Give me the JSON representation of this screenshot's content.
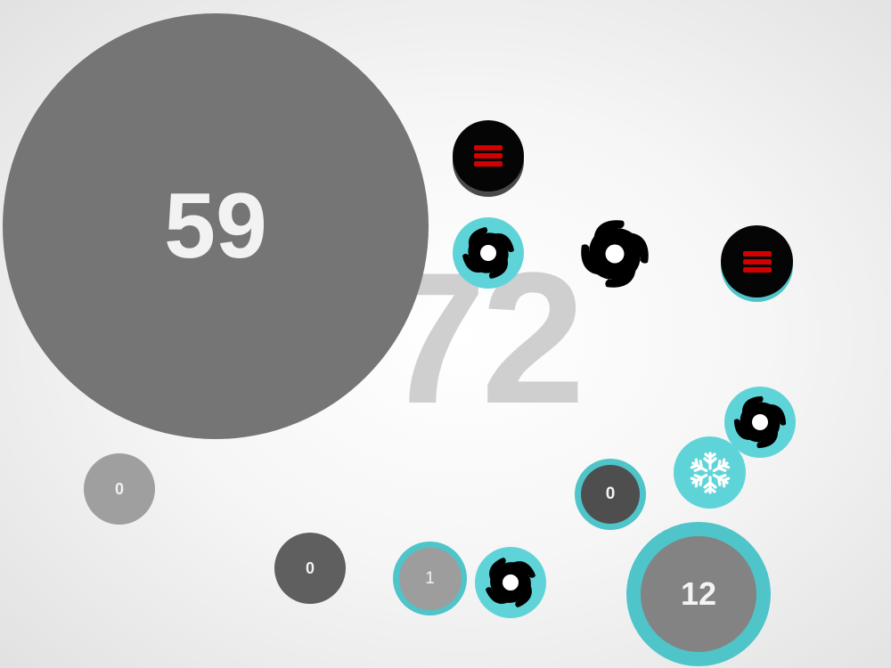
{
  "game": {
    "background_score": "72",
    "score_bubble": "59"
  },
  "bubbles": {
    "gray_zero": "0",
    "dark_zero": "0",
    "teal_one": "1",
    "teal_dark_zero": "0",
    "teal_twelve": "12"
  },
  "buttons": {
    "menu_top_icon": "menu-icon",
    "menu_right_icon": "menu-icon"
  },
  "powerups": {
    "saw_icon": "saw-blade-icon",
    "freeze_icon": "snowflake-icon"
  },
  "colors": {
    "teal": "#4fc4c9",
    "teal_light": "#5fd4d8",
    "menu_red": "#d00000",
    "bubble_gray": "#757575",
    "background_number": "#cfcfcf"
  }
}
